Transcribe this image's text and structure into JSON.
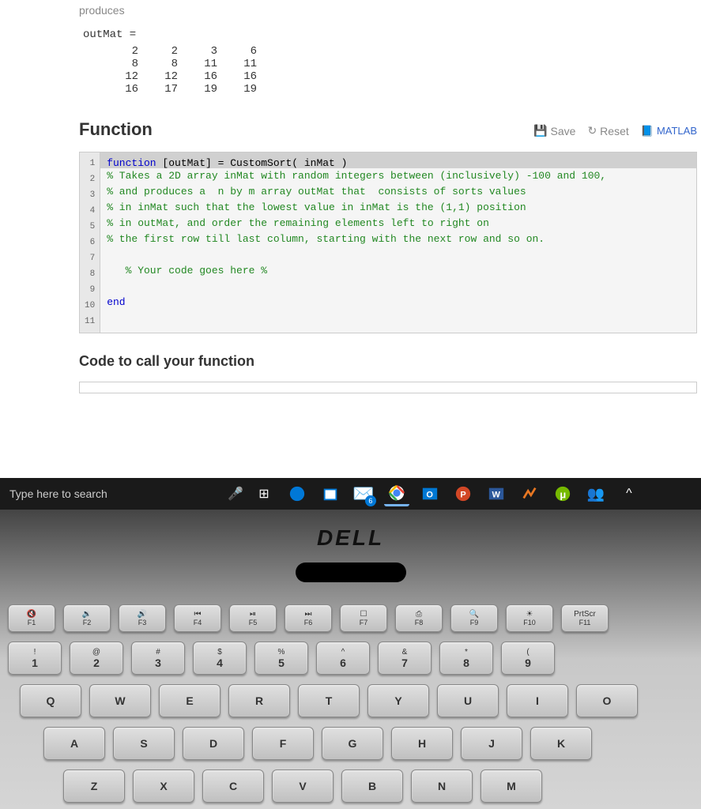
{
  "produces_label": "produces",
  "output": {
    "header": "outMat =",
    "rows": [
      [
        "2",
        "2",
        "3",
        "6"
      ],
      [
        "8",
        "8",
        "11",
        "11"
      ],
      [
        "12",
        "12",
        "16",
        "16"
      ],
      [
        "16",
        "17",
        "19",
        "19"
      ]
    ]
  },
  "function_title": "Function",
  "toolbar": {
    "save": "Save",
    "reset": "Reset",
    "matlab": "MATLAB"
  },
  "code": {
    "lines": [
      "function [outMat] = CustomSort( inMat )",
      "% Takes a 2D array inMat with random integers between (inclusively) -100 and 100,",
      "% and produces a  n by m array outMat that  consists of sorts values",
      "% in inMat such that the lowest value in inMat is the (1,1) position",
      "% in outMat, and order the remaining elements left to right on",
      "% the first row till last column, starting with the next row and so on.",
      "",
      "   % Your code goes here %",
      "",
      "end",
      ""
    ]
  },
  "call_title": "Code to call your function",
  "taskbar": {
    "search_placeholder": "Type here to search",
    "mail_badge": "6"
  },
  "laptop": {
    "brand": "DELL"
  },
  "keyboard": {
    "fn_row": [
      {
        "icon": "🔇",
        "label": "F1"
      },
      {
        "icon": "🔉",
        "label": "F2"
      },
      {
        "icon": "🔊",
        "label": "F3"
      },
      {
        "icon": "⏮",
        "label": "F4"
      },
      {
        "icon": "⏯",
        "label": "F5"
      },
      {
        "icon": "⏭",
        "label": "F6"
      },
      {
        "icon": "☐",
        "label": "F7"
      },
      {
        "icon": "⎙",
        "label": "F8"
      },
      {
        "icon": "🔍",
        "label": "F9"
      },
      {
        "icon": "☀",
        "label": "F10"
      },
      {
        "icon": "PrtScr",
        "label": "F11"
      }
    ],
    "num_row": [
      {
        "top": "!",
        "main": "1"
      },
      {
        "top": "@",
        "main": "2"
      },
      {
        "top": "#",
        "main": "3"
      },
      {
        "top": "$",
        "main": "4"
      },
      {
        "top": "%",
        "main": "5"
      },
      {
        "top": "^",
        "main": "6"
      },
      {
        "top": "&",
        "main": "7"
      },
      {
        "top": "*",
        "main": "8"
      },
      {
        "top": "(",
        "main": "9"
      }
    ],
    "qwerty_row": [
      "Q",
      "W",
      "E",
      "R",
      "T",
      "Y",
      "U",
      "I",
      "O"
    ],
    "asdf_row": [
      "A",
      "S",
      "D",
      "F",
      "G",
      "H",
      "J",
      "K"
    ],
    "zxcv_row": [
      "Z",
      "X",
      "C",
      "V",
      "B",
      "N",
      "M"
    ]
  }
}
